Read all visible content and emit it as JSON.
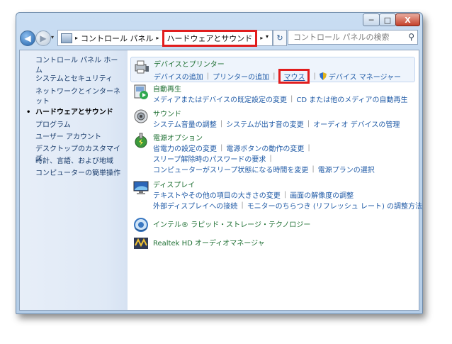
{
  "window_controls": {
    "minimize": "─",
    "maximize": "□",
    "close": "X"
  },
  "nav": {
    "back_glyph": "◀",
    "forward_glyph": "▶",
    "dropdown_glyph": "▾"
  },
  "address": {
    "breadcrumb": [
      "コントロール パネル",
      "ハードウェアとサウンド"
    ],
    "separator": "▸",
    "dropdown_glyph": "▾",
    "refresh_glyph": "↻"
  },
  "search": {
    "placeholder": "コントロール パネルの検索",
    "glyph": "⚲"
  },
  "left_nav": {
    "home": "コントロール パネル ホーム",
    "items": [
      {
        "label": "システムとセキュリティ",
        "active": false
      },
      {
        "label": "ネットワークとインターネット",
        "active": false
      },
      {
        "label": "ハードウェアとサウンド",
        "active": true
      },
      {
        "label": "プログラム",
        "active": false
      },
      {
        "label": "ユーザー アカウント",
        "active": false
      },
      {
        "label": "デスクトップのカスタマイズ",
        "active": false
      },
      {
        "label": "時計、言語、および地域",
        "active": false
      },
      {
        "label": "コンピューターの簡単操作",
        "active": false
      }
    ],
    "bullet": "•"
  },
  "sections": {
    "devices": {
      "title": "デバイスとプリンター",
      "links": [
        "デバイスの追加",
        "プリンターの追加",
        "マウス",
        "デバイス マネージャー"
      ],
      "icon": "printer-icon"
    },
    "autoplay": {
      "title": "自動再生",
      "links": [
        "メディアまたはデバイスの既定設定の変更",
        "CD または他のメディアの自動再生"
      ],
      "icon": "autoplay-icon"
    },
    "sound": {
      "title": "サウンド",
      "links": [
        "システム音量の調整",
        "システムが出す音の変更",
        "オーディオ デバイスの管理"
      ],
      "icon": "speaker-icon"
    },
    "power": {
      "title": "電源オプション",
      "links": [
        "省電力の設定の変更",
        "電源ボタンの動作の変更",
        "スリープ解除時のパスワードの要求",
        "コンピューターがスリープ状態になる時間を変更",
        "電源プランの選択"
      ],
      "icon": "power-icon"
    },
    "display": {
      "title": "ディスプレイ",
      "links": [
        "テキストやその他の項目の大きさの変更",
        "画面の解像度の調整",
        "外部ディスプレイへの接続",
        "モニターのちらつき (リフレッシュ レート) の調整方法"
      ],
      "icon": "monitor-icon"
    },
    "intel": {
      "title": "インテル® ラピッド・ストレージ・テクノロジー",
      "icon": "intel-storage-icon"
    },
    "realtek": {
      "title": "Realtek HD オーディオマネージャ",
      "icon": "realtek-icon"
    }
  },
  "colors": {
    "highlight_box": "#e11d1d",
    "link": "#1f5aa6",
    "section_title": "#1d6f32",
    "nav_link": "#1a3c6b"
  }
}
